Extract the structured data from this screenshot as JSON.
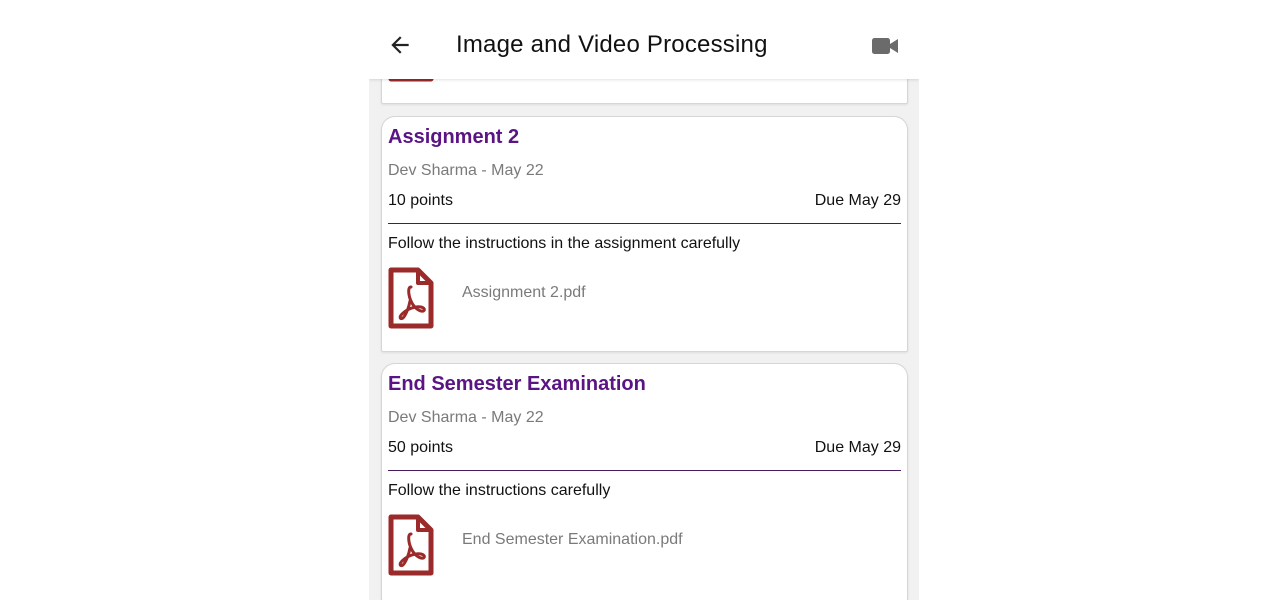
{
  "appbar": {
    "title": "Image and Video Processing",
    "back_icon": "arrow-left-icon",
    "video_icon": "video-camera-icon"
  },
  "colors": {
    "title_purple": "#5a1483",
    "pdf_red": "#9b2a2a",
    "divider": "#4a1a5e"
  },
  "cards": [
    {
      "title": "Assignment 2",
      "meta": "Dev Sharma - May 22",
      "points": "10 points",
      "due": "Due May 29",
      "description": "Follow the instructions in the assignment carefully",
      "attachment": "Assignment 2.pdf",
      "attachment_icon": "pdf-file-icon"
    },
    {
      "title": "End Semester Examination",
      "meta": "Dev Sharma - May 22",
      "points": "50 points",
      "due": "Due May 29",
      "description": "Follow the instructions carefully",
      "attachment": "End Semester Examination.pdf",
      "attachment_icon": "pdf-file-icon"
    }
  ]
}
